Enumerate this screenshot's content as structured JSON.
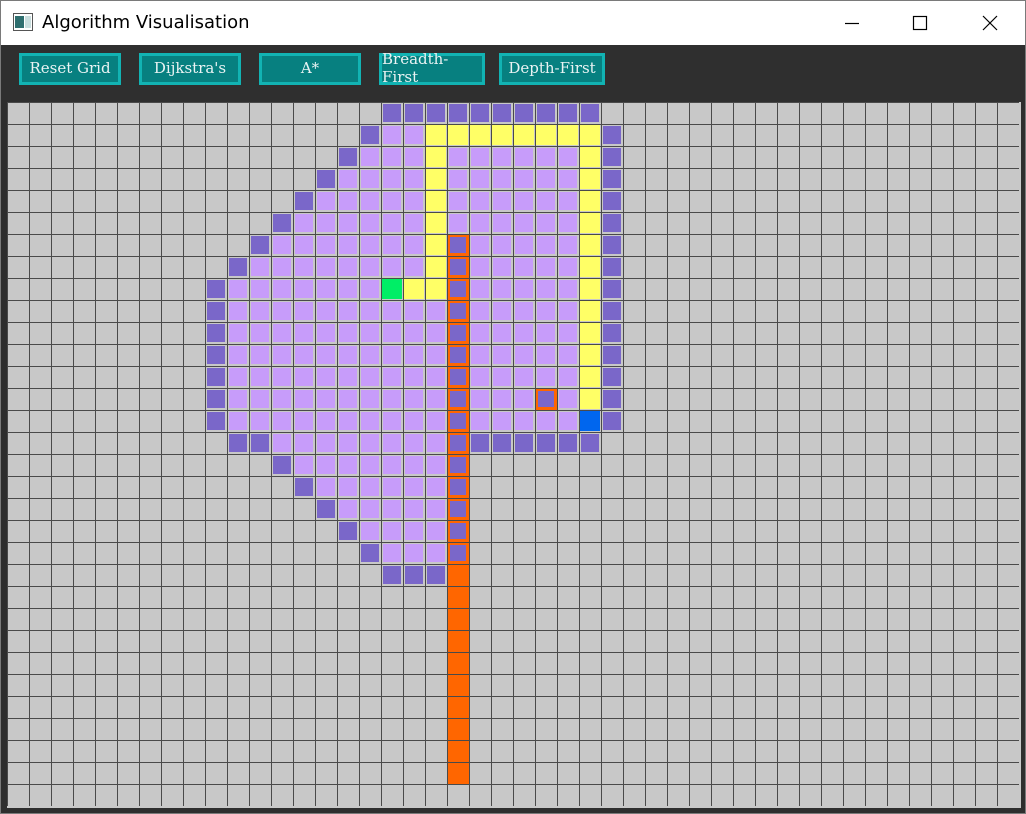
{
  "window": {
    "title": "Algorithm Visualisation",
    "controls": {
      "minimize_icon": "minimize-icon",
      "maximize_icon": "maximize-icon",
      "close_icon": "close-icon"
    }
  },
  "toolbar": {
    "buttons": [
      "Reset Grid",
      "Dijkstra's",
      "A*",
      "Breadth-First",
      "Depth-First"
    ]
  },
  "colors": {
    "grid_bg": "#c8c8c8",
    "grid_line": "#4a4a4a",
    "button_bg": "#078080",
    "button_border": "#12b3b3",
    "visited": "#c79cfa",
    "frontier": "#7a67c9",
    "path": "#ffff66",
    "wall": "#ff6600",
    "start": "#00ee66",
    "end": "#0066ee"
  },
  "grid": {
    "cols": 46,
    "rows": 32,
    "start": [
      17,
      8
    ],
    "end": [
      26,
      14
    ],
    "walls": [
      [
        20,
        6
      ],
      [
        20,
        7
      ],
      [
        20,
        8
      ],
      [
        20,
        9
      ],
      [
        20,
        10
      ],
      [
        20,
        11
      ],
      [
        20,
        12
      ],
      [
        20,
        13
      ],
      [
        20,
        14
      ],
      [
        20,
        15
      ],
      [
        20,
        16
      ],
      [
        20,
        17
      ],
      [
        20,
        18
      ],
      [
        20,
        19
      ],
      [
        20,
        20
      ],
      [
        20,
        21
      ],
      [
        20,
        22
      ],
      [
        20,
        23
      ],
      [
        20,
        24
      ],
      [
        20,
        25
      ],
      [
        20,
        26
      ],
      [
        20,
        27
      ],
      [
        20,
        28
      ],
      [
        20,
        29
      ],
      [
        20,
        30
      ],
      [
        24,
        13
      ]
    ],
    "path": [
      [
        18,
        8
      ],
      [
        19,
        8
      ],
      [
        19,
        7
      ],
      [
        19,
        6
      ],
      [
        19,
        5
      ],
      [
        19,
        4
      ],
      [
        19,
        3
      ],
      [
        19,
        2
      ],
      [
        19,
        1
      ],
      [
        20,
        1
      ],
      [
        21,
        1
      ],
      [
        22,
        1
      ],
      [
        23,
        1
      ],
      [
        24,
        1
      ],
      [
        25,
        1
      ],
      [
        26,
        1
      ],
      [
        26,
        2
      ],
      [
        26,
        3
      ],
      [
        26,
        4
      ],
      [
        26,
        5
      ],
      [
        26,
        6
      ],
      [
        26,
        7
      ],
      [
        26,
        8
      ],
      [
        26,
        9
      ],
      [
        26,
        10
      ],
      [
        26,
        11
      ],
      [
        26,
        12
      ],
      [
        26,
        13
      ]
    ],
    "frontier": [
      [
        17,
        0
      ],
      [
        18,
        0
      ],
      [
        19,
        0
      ],
      [
        20,
        0
      ],
      [
        21,
        0
      ],
      [
        22,
        0
      ],
      [
        23,
        0
      ],
      [
        24,
        0
      ],
      [
        25,
        0
      ],
      [
        26,
        0
      ],
      [
        16,
        1
      ],
      [
        27,
        1
      ],
      [
        15,
        2
      ],
      [
        27,
        2
      ],
      [
        14,
        3
      ],
      [
        27,
        3
      ],
      [
        13,
        4
      ],
      [
        27,
        4
      ],
      [
        12,
        5
      ],
      [
        27,
        5
      ],
      [
        11,
        6
      ],
      [
        27,
        6
      ],
      [
        10,
        7
      ],
      [
        27,
        7
      ],
      [
        9,
        8
      ],
      [
        27,
        8
      ],
      [
        9,
        9
      ],
      [
        27,
        9
      ],
      [
        9,
        10
      ],
      [
        27,
        10
      ],
      [
        9,
        11
      ],
      [
        27,
        11
      ],
      [
        9,
        12
      ],
      [
        27,
        12
      ],
      [
        9,
        13
      ],
      [
        27,
        13
      ],
      [
        9,
        14
      ],
      [
        27,
        14
      ],
      [
        10,
        15
      ],
      [
        11,
        15
      ],
      [
        21,
        15
      ],
      [
        22,
        15
      ],
      [
        23,
        15
      ],
      [
        24,
        15
      ],
      [
        25,
        15
      ],
      [
        26,
        15
      ],
      [
        12,
        16
      ],
      [
        13,
        17
      ],
      [
        14,
        18
      ],
      [
        15,
        19
      ],
      [
        16,
        20
      ],
      [
        17,
        21
      ],
      [
        18,
        21
      ],
      [
        19,
        21
      ]
    ],
    "visited_rows": [
      {
        "row": 1,
        "from": 17,
        "to": 18
      },
      {
        "row": 2,
        "from": 16,
        "to": 25
      },
      {
        "row": 3,
        "from": 15,
        "to": 25
      },
      {
        "row": 4,
        "from": 14,
        "to": 25
      },
      {
        "row": 5,
        "from": 13,
        "to": 25
      },
      {
        "row": 6,
        "from": 12,
        "to": 25
      },
      {
        "row": 7,
        "from": 11,
        "to": 25
      },
      {
        "row": 8,
        "from": 10,
        "to": 25
      },
      {
        "row": 9,
        "from": 10,
        "to": 25
      },
      {
        "row": 10,
        "from": 10,
        "to": 25
      },
      {
        "row": 11,
        "from": 10,
        "to": 25
      },
      {
        "row": 12,
        "from": 10,
        "to": 25
      },
      {
        "row": 13,
        "from": 10,
        "to": 25
      },
      {
        "row": 14,
        "from": 10,
        "to": 25
      },
      {
        "row": 15,
        "from": 12,
        "to": 19
      },
      {
        "row": 16,
        "from": 13,
        "to": 19
      },
      {
        "row": 17,
        "from": 14,
        "to": 19
      },
      {
        "row": 18,
        "from": 15,
        "to": 19
      },
      {
        "row": 19,
        "from": 16,
        "to": 19
      },
      {
        "row": 20,
        "from": 17,
        "to": 19
      }
    ]
  }
}
